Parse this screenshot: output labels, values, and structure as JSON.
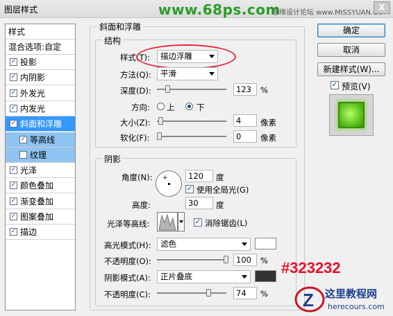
{
  "window": {
    "title": "图层样式",
    "watermark": "www.68ps.com",
    "watermark2": "思缘设计论坛 www.MISSYUAN.COM",
    "close": "X"
  },
  "sidebar": {
    "header": "样式",
    "blend_options": "混合选项:自定",
    "items": [
      {
        "label": "投影",
        "checked": true
      },
      {
        "label": "内阴影",
        "checked": true
      },
      {
        "label": "外发光",
        "checked": true
      },
      {
        "label": "内发光",
        "checked": true
      },
      {
        "label": "斜面和浮雕",
        "checked": true,
        "selected": true
      },
      {
        "label": "等高线",
        "checked": true,
        "sub": true
      },
      {
        "label": "纹理",
        "checked": false,
        "sub": true
      },
      {
        "label": "光泽",
        "checked": true
      },
      {
        "label": "颜色叠加",
        "checked": true
      },
      {
        "label": "渐变叠加",
        "checked": true
      },
      {
        "label": "图案叠加",
        "checked": true
      },
      {
        "label": "描边",
        "checked": true
      }
    ]
  },
  "bevel": {
    "group_title": "斜面和浮雕",
    "structure": {
      "title": "结构",
      "style_label": "样式(T):",
      "style_value": "描边浮雕",
      "technique_label": "方法(Q):",
      "technique_value": "平滑",
      "depth_label": "深度(D):",
      "depth_value": "123",
      "depth_unit": "%",
      "depth_level": 0.12,
      "direction_label": "方向:",
      "dir_up": "上",
      "dir_down": "下",
      "size_label": "大小(Z):",
      "size_value": "4",
      "size_unit": "像素",
      "size_level": 0.02,
      "soften_label": "软化(F):",
      "soften_value": "0",
      "soften_unit": "像素",
      "soften_level": 0
    },
    "shading": {
      "title": "阴影",
      "angle_label": "角度(N):",
      "angle_value": "120",
      "angle_unit": "度",
      "global_light": "使用全局光(G)",
      "altitude_label": "高度:",
      "altitude_value": "30",
      "altitude_unit": "度",
      "gloss_contour_label": "光泽等高线:",
      "anti_alias": "消除锯齿(L)",
      "highlight_mode_label": "高光模式(H):",
      "highlight_mode_value": "滤色",
      "highlight_color": "#ffffff",
      "highlight_opacity_label": "不透明度(O):",
      "highlight_opacity_value": "100",
      "highlight_opacity_unit": "%",
      "highlight_opacity_level": 1.0,
      "shadow_mode_label": "阴影模式(A):",
      "shadow_mode_value": "正片叠底",
      "shadow_color": "#323232",
      "shadow_opacity_label": "不透明度(C):",
      "shadow_opacity_value": "74",
      "shadow_opacity_unit": "%",
      "shadow_opacity_level": 0.74
    }
  },
  "buttons": {
    "ok": "确定",
    "cancel": "取消",
    "new_style": "新建样式(W)...",
    "preview": "预览(V)"
  },
  "annotation": {
    "color_code": "#323232",
    "color": "#e8102a"
  },
  "logo": {
    "text": "这里教程网",
    "url": "herecours.com"
  }
}
